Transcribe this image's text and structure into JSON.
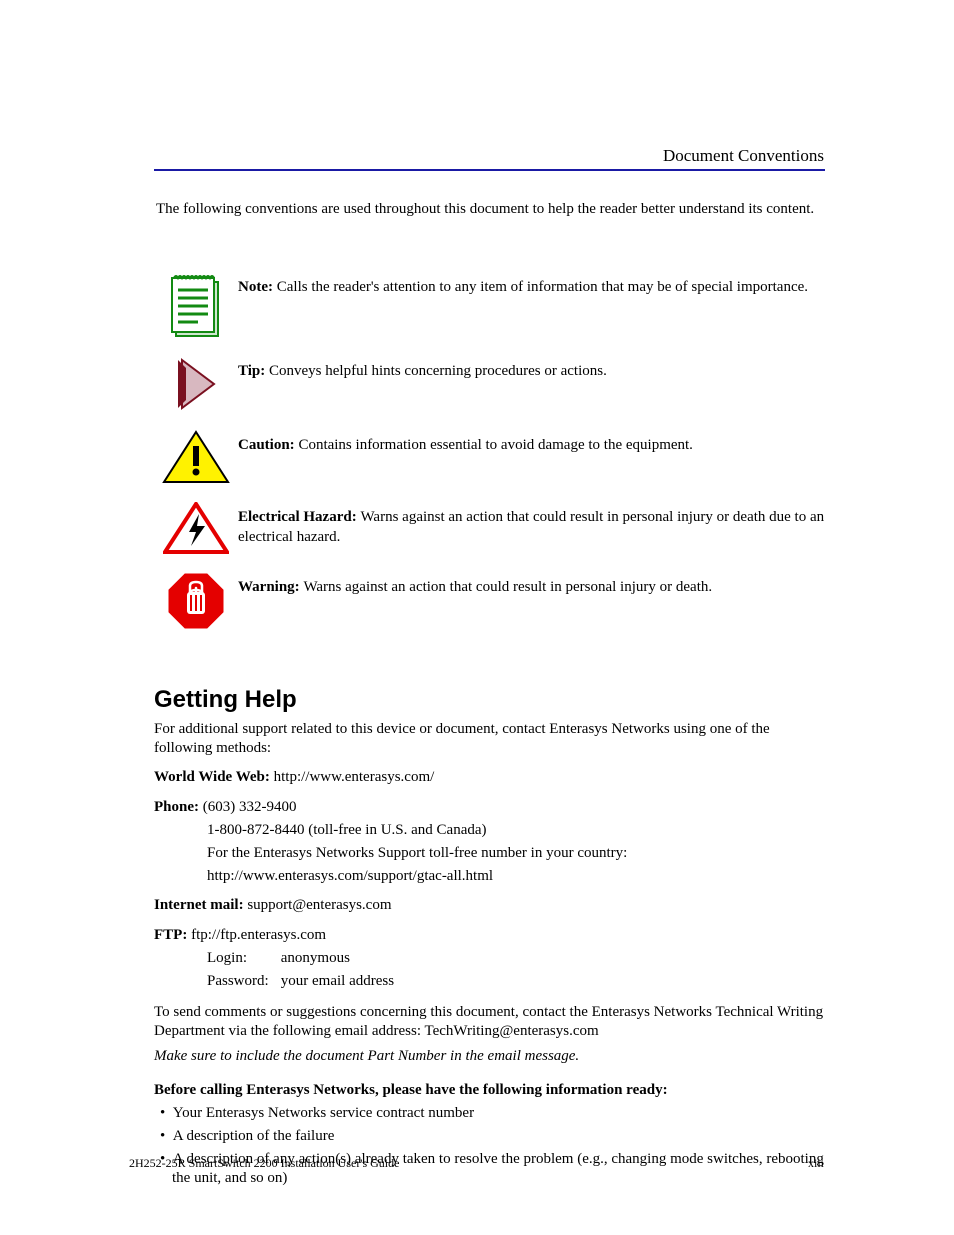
{
  "header": {
    "right_text": "Document Conventions"
  },
  "intro": "The following conventions are used throughout this document to help the reader better understand its content.",
  "conventions": [
    {
      "icon": "note-icon",
      "bold": "Note: ",
      "text": "Calls the reader's attention to any item of information that may be of special importance."
    },
    {
      "icon": "tip-icon",
      "bold": "Tip: ",
      "text": "Conveys helpful hints concerning procedures or actions."
    },
    {
      "icon": "caution-icon",
      "bold": "Caution: ",
      "text": "Contains information essential to avoid damage to the equipment."
    },
    {
      "icon": "hazard-icon",
      "bold": "Electrical Hazard: ",
      "text": "Warns against an action that could result in personal injury or death due to an electrical hazard."
    },
    {
      "icon": "warning-icon",
      "bold": "Warning: ",
      "text": "Warns against an action that could result in personal injury or death."
    }
  ],
  "support": {
    "heading": "Getting Help",
    "para1": "For additional support related to this device or document, contact Enterasys Networks using one of the following methods:",
    "www_label": "World Wide Web:",
    "www_value": "http://www.enterasys.com/",
    "phone_label": "Phone:",
    "phone_value1": "(603) 332-9400",
    "phone_value2": "1-800-872-8440 (toll-free in U.S. and Canada)",
    "phone_note_prefix": "For the Enterasys Networks Support toll-free number in your country:",
    "phone_note_url": "http://www.enterasys.com/support/gtac-all.html",
    "ip_label": "Internet mail:",
    "ip_value": "support@enterasys.com",
    "ftp_label": "FTP:",
    "ftp_value": "ftp://ftp.enterasys.com",
    "login_label": "Login:",
    "login_value": "anonymous",
    "pwd_label": "Password:",
    "pwd_value": "your email address",
    "rma_line": "To send comments or suggestions concerning this document, contact the Enterasys Networks Technical Writing Department via the following email address: TechWriting@enterasys.com",
    "rma_note": "Make sure to include the document Part Number in the email message."
  },
  "before_calling": {
    "intro": "Before calling Enterasys Networks, please have the following information ready:",
    "items": [
      "Your Enterasys Networks service contract number",
      "A description of the failure",
      "A description of any action(s) already taken to resolve the problem (e.g., changing mode switches, rebooting the unit, and so on)"
    ]
  },
  "footer": {
    "left": "2H252-25R SmartSwitch 2200 Installation User's Guide",
    "right": "xiii"
  }
}
